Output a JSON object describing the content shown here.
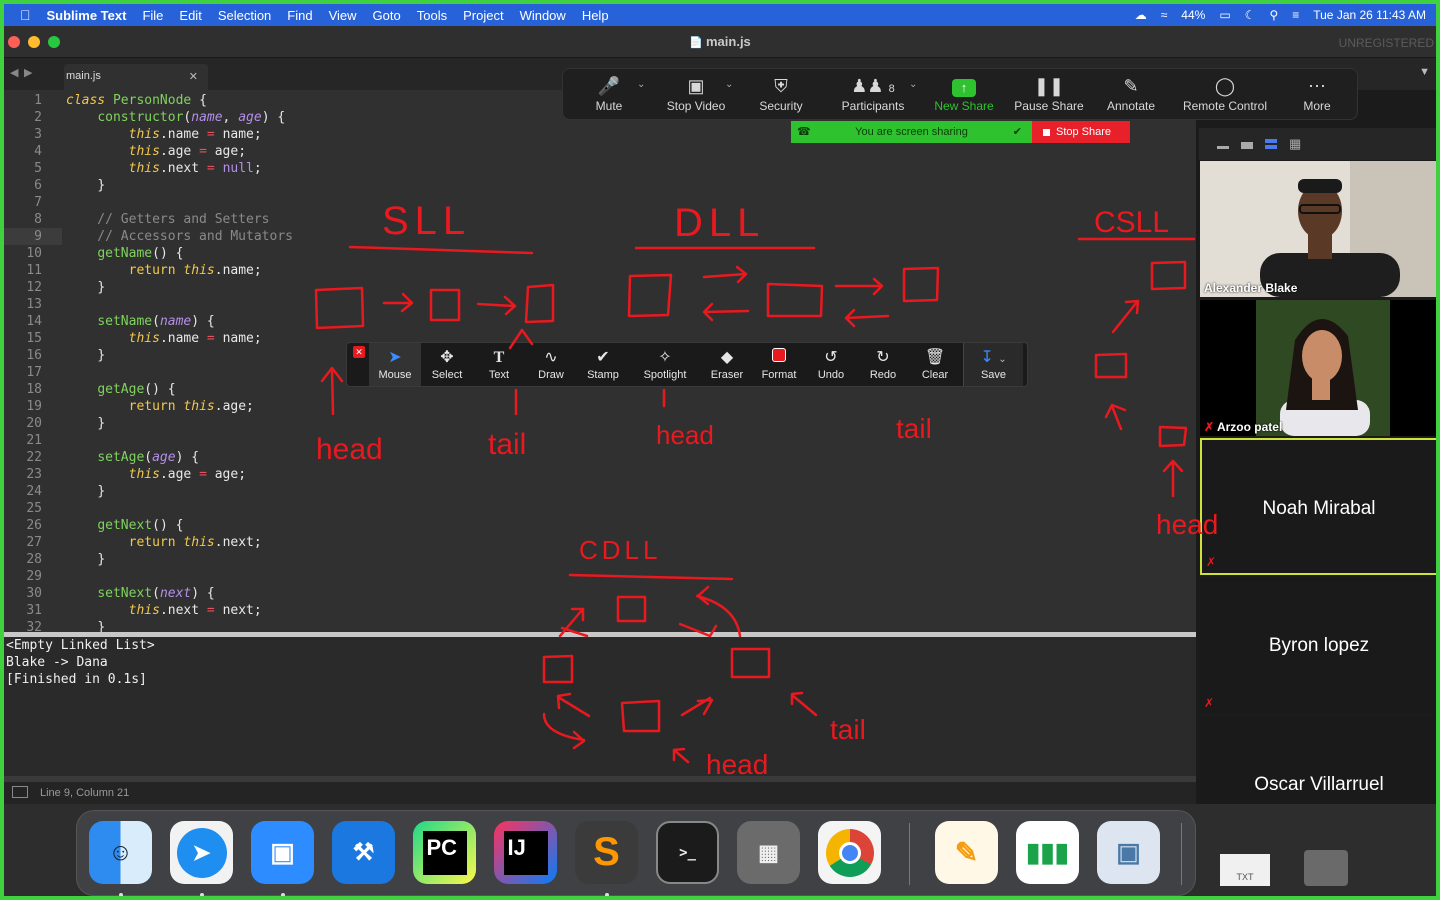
{
  "menubar": {
    "app": "Sublime Text",
    "items": [
      "File",
      "Edit",
      "Selection",
      "Find",
      "View",
      "Goto",
      "Tools",
      "Project",
      "Window",
      "Help"
    ],
    "battery": "44%",
    "datetime": "Tue Jan 26  11:43 AM"
  },
  "window": {
    "title": "main.js",
    "unregistered": "UNREGISTERED",
    "tab": "main.js"
  },
  "code": {
    "lines": [
      "class PersonNode {",
      "    constructor(name, age) {",
      "        this.name = name;",
      "        this.age = age;",
      "        this.next = null;",
      "    }",
      "",
      "    // Getters and Setters",
      "    // Accessors and Mutators",
      "    getName() {",
      "        return this.name;",
      "    }",
      "",
      "    setName(name) {",
      "        this.name = name;",
      "    }",
      "",
      "    getAge() {",
      "        return this.age;",
      "    }",
      "",
      "    setAge(age) {",
      "        this.age = age;",
      "    }",
      "",
      "    getNext() {",
      "        return this.next;",
      "    }",
      "",
      "    setNext(next) {",
      "        this.next = next;",
      "    }"
    ],
    "highlight_line": 9
  },
  "console": {
    "lines": [
      "<Empty Linked List>",
      "Blake -> Dana",
      "[Finished in 0.1s]"
    ]
  },
  "status": {
    "position": "Line 9, Column 21"
  },
  "zoom": {
    "buttons": [
      {
        "label": "Mute",
        "icon": "microphone-icon"
      },
      {
        "label": "Stop Video",
        "icon": "video-camera-icon"
      },
      {
        "label": "Security",
        "icon": "shield-icon"
      },
      {
        "label": "Participants",
        "icon": "participants-icon",
        "count": "8"
      },
      {
        "label": "New Share",
        "icon": "share-arrow-icon"
      },
      {
        "label": "Pause Share",
        "icon": "pause-icon"
      },
      {
        "label": "Annotate",
        "icon": "pencil-icon"
      },
      {
        "label": "Remote Control",
        "icon": "mouse-icon"
      },
      {
        "label": "More",
        "icon": "more-dots-icon"
      }
    ],
    "sharing_text": "You are screen sharing",
    "stop_share": "Stop Share"
  },
  "annotate_toolbar": {
    "tools": [
      {
        "label": "Mouse",
        "icon": "cursor-arrow-icon"
      },
      {
        "label": "Select",
        "icon": "move-icon"
      },
      {
        "label": "Text",
        "icon": "text-t-icon"
      },
      {
        "label": "Draw",
        "icon": "squiggle-icon"
      },
      {
        "label": "Stamp",
        "icon": "checkmark-icon"
      },
      {
        "label": "Spotlight",
        "icon": "magic-wand-icon"
      },
      {
        "label": "Eraser",
        "icon": "eraser-icon"
      },
      {
        "label": "Format",
        "icon": "color-swatch-icon"
      },
      {
        "label": "Undo",
        "icon": "undo-icon"
      },
      {
        "label": "Redo",
        "icon": "redo-icon"
      },
      {
        "label": "Clear",
        "icon": "trash-icon"
      },
      {
        "label": "Save",
        "icon": "save-icon"
      }
    ]
  },
  "participants": [
    {
      "name": "Alexander Blake",
      "video": true
    },
    {
      "name": "Arzoo patel",
      "video": true,
      "muted": true
    },
    {
      "name": "Noah Mirabal",
      "video": false,
      "muted": true,
      "active": true
    },
    {
      "name": "Byron lopez",
      "video": false,
      "muted": true
    },
    {
      "name": "Oscar Villarruel",
      "video": false
    }
  ],
  "ink_labels": {
    "sll": "SLL",
    "dll": "DLL",
    "csll": "CSLL",
    "cdll": "CDLL",
    "head": "head",
    "tail": "tail"
  },
  "dock": {
    "apps": [
      "Finder",
      "Safari",
      "Zoom",
      "Xcode",
      "PyCharm",
      "IntelliJ IDEA",
      "Sublime Text",
      "Terminal",
      "Calculator",
      "Chrome",
      "Pages",
      "Numbers",
      "Preview"
    ],
    "pycharm_badge": "PC",
    "intellij_badge": "IJ",
    "terminal_prompt": ">_",
    "txt_icon": "TXT"
  },
  "colors": {
    "ink": "#e8191f",
    "menubar": "#2862d8",
    "accent_green": "#2ec22e",
    "frame": "#3fd13f"
  }
}
